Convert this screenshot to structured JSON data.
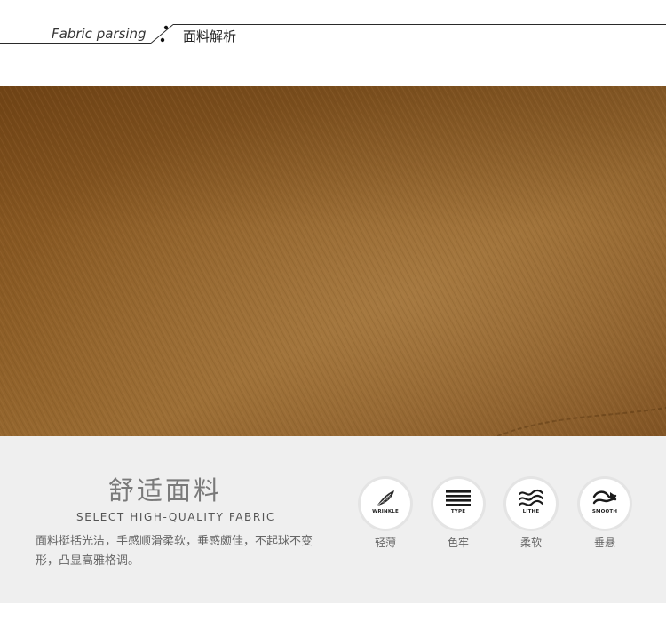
{
  "header": {
    "en_title": "Fabric parsing",
    "cn_title": "面料解析"
  },
  "fabric_photo": {
    "description_icon": "fabric-texture-image",
    "color": "#8a5a22"
  },
  "panel": {
    "title": "舒适面料",
    "subtitle": "SELECT HIGH-QUALITY FABRIC",
    "description": "面料挺括光洁，手感顺滑柔软，垂感颇佳，不起球不变形，凸显高雅格调。"
  },
  "features": [
    {
      "icon": "feather-icon",
      "en": "WRINKLE",
      "cn": "轻薄"
    },
    {
      "icon": "stripes-icon",
      "en": "TYPE",
      "cn": "色牢"
    },
    {
      "icon": "waves-icon",
      "en": "LITHE",
      "cn": "柔软"
    },
    {
      "icon": "smooth-icon",
      "en": "SMOOTH",
      "cn": "垂悬"
    }
  ]
}
